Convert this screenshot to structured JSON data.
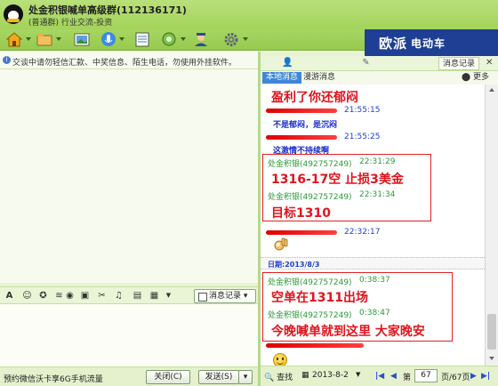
{
  "window": {
    "title": "处金积银喊单高级群(112136171)",
    "subtitle": "(普通群) 行业交流-投资"
  },
  "brand": {
    "text": "欧派",
    "text2": "电动车",
    "color": "#1e3f93"
  },
  "notice": {
    "text": "交谈中请勿轻信汇款、中奖信息、陌生电话，勿使用外挂软件。"
  },
  "input_toolbar": {
    "msg_record_label": "消息记录"
  },
  "bottom_left": {
    "ad_text": "预约微信沃卡享6G手机流量",
    "close_label": "关闭(C)",
    "send_label": "发送(S)"
  },
  "right_panel": {
    "msg_record_tab": "消息记录",
    "local_tab": "本地消息",
    "roaming_tab": "漫游消息",
    "more_label": "更多"
  },
  "history": {
    "line1": "盈利了你还郁闷",
    "ts1": "21:55:15",
    "line2": "不是郁闷，是沉闷",
    "ts2": "21:55:25",
    "line3": "这激情不持续啊",
    "sender1": "处金积银(492757249)",
    "time1": "22:31:29",
    "msg1": "1316-17空 止损3美金",
    "sender2": "处金积银(492757249)",
    "time2": "22:31:34",
    "msg2": "目标1310",
    "ts3": "22:32:17",
    "date_label": "日期:2013/8/3",
    "sender3": "处金积银(492757249)",
    "time3": "0:38:37",
    "msg3": "空单在1311出场",
    "sender4": "处金积银(492757249)",
    "time4": "0:38:47",
    "msg4": "今晚喊单就到这里 大家晚安"
  },
  "bottom_right": {
    "search_label": "查找",
    "date_value": "2013-8-2",
    "page_prefix": "第",
    "page_value": "67",
    "page_suffix": "页/67页"
  },
  "colors": {
    "highlight_red": "#e0141c",
    "sender_green": "#2c9a3a",
    "time_blue": "#1e3fd0",
    "chrome_green": "#a3d35a"
  }
}
